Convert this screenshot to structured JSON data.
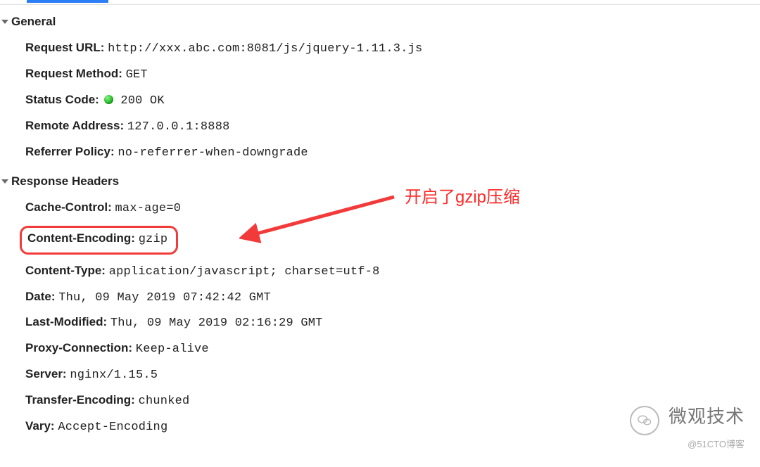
{
  "sections": {
    "general": {
      "title": "General",
      "request_url": {
        "label": "Request URL:",
        "value": "http://xxx.abc.com:8081/js/jquery-1.11.3.js"
      },
      "request_method": {
        "label": "Request Method:",
        "value": "GET"
      },
      "status_code": {
        "label": "Status Code:",
        "value": "200 OK"
      },
      "remote_address": {
        "label": "Remote Address:",
        "value": "127.0.0.1:8888"
      },
      "referrer_policy": {
        "label": "Referrer Policy:",
        "value": "no-referrer-when-downgrade"
      }
    },
    "response_headers": {
      "title": "Response Headers",
      "cache_control": {
        "label": "Cache-Control:",
        "value": "max-age=0"
      },
      "content_encoding": {
        "label": "Content-Encoding:",
        "value": "gzip"
      },
      "content_type": {
        "label": "Content-Type:",
        "value": "application/javascript; charset=utf-8"
      },
      "date": {
        "label": "Date:",
        "value": "Thu, 09 May 2019 07:42:42 GMT"
      },
      "last_modified": {
        "label": "Last-Modified:",
        "value": "Thu, 09 May 2019 02:16:29 GMT"
      },
      "proxy_connection": {
        "label": "Proxy-Connection:",
        "value": "Keep-alive"
      },
      "server": {
        "label": "Server:",
        "value": "nginx/1.15.5"
      },
      "transfer_encoding": {
        "label": "Transfer-Encoding:",
        "value": "chunked"
      },
      "vary": {
        "label": "Vary:",
        "value": "Accept-Encoding"
      }
    }
  },
  "annotation": {
    "text": "开启了gzip压缩"
  },
  "watermark": {
    "main": "微观技术",
    "sub": "@51CTO博客"
  }
}
